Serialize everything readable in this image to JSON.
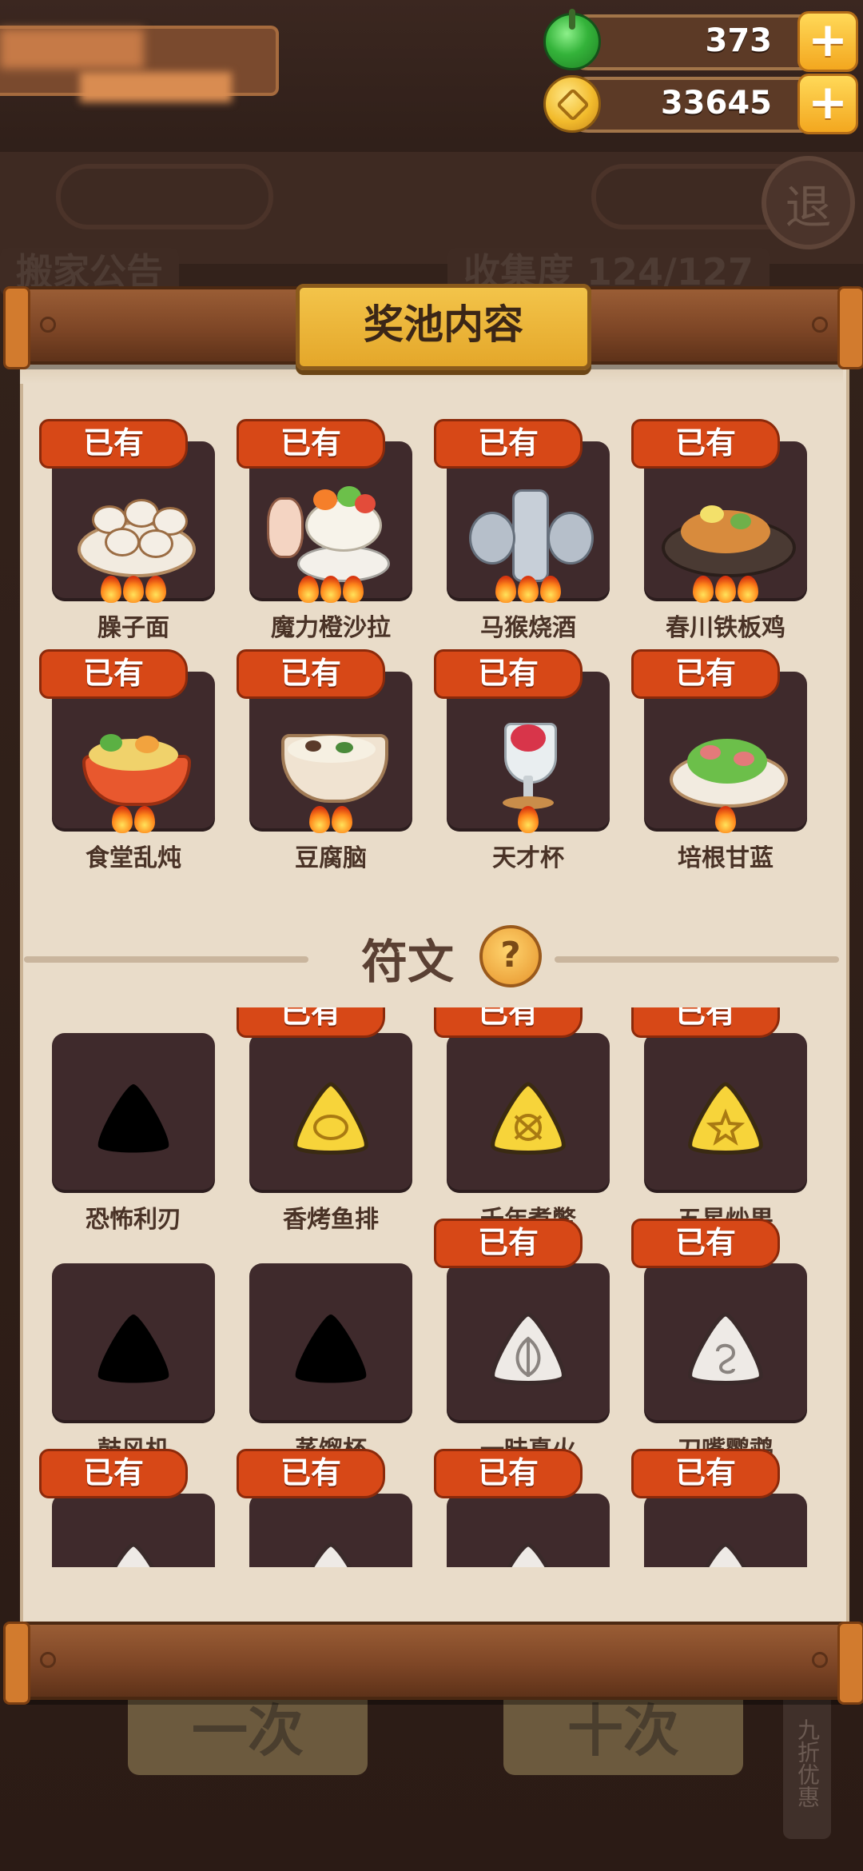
{
  "currency": {
    "gems": "373",
    "coins": "33645",
    "plus_label": "+"
  },
  "background": {
    "exit_label": "退",
    "left_label": "搬家公告",
    "right_label": "收集度 124/127",
    "button_one": "一次",
    "button_ten": "十次",
    "discount": "九折优惠"
  },
  "panel": {
    "title": "奖池内容",
    "owned_label": "已有",
    "dishes": [
      {
        "name": "臊子面",
        "owned": true,
        "flames": 3
      },
      {
        "name": "魔力橙沙拉",
        "owned": true,
        "flames": 3
      },
      {
        "name": "马猴烧酒",
        "owned": true,
        "flames": 3
      },
      {
        "name": "春川铁板鸡",
        "owned": true,
        "flames": 3
      },
      {
        "name": "食堂乱炖",
        "owned": true,
        "flames": 2
      },
      {
        "name": "豆腐脑",
        "owned": true,
        "flames": 2
      },
      {
        "name": "天才杯",
        "owned": true,
        "flames": 1
      },
      {
        "name": "培根甘蓝",
        "owned": true,
        "flames": 1
      }
    ],
    "runes_section_title": "符文",
    "help_label": "?",
    "runes": [
      {
        "name": "恐怖利刃",
        "owned": false,
        "style": "locked"
      },
      {
        "name": "香烤鱼排",
        "owned": true,
        "style": "gold"
      },
      {
        "name": "千年煮鳖",
        "owned": true,
        "style": "gold"
      },
      {
        "name": "五星炒果",
        "owned": true,
        "style": "gold"
      },
      {
        "name": "鼓风机",
        "owned": false,
        "style": "locked"
      },
      {
        "name": "蒸馏杯",
        "owned": false,
        "style": "locked"
      },
      {
        "name": "一昧真火",
        "owned": true,
        "style": "silver"
      },
      {
        "name": "刀嘴鹦鹉",
        "owned": true,
        "style": "silver"
      },
      {
        "name": "",
        "owned": true,
        "style": "silver"
      },
      {
        "name": "",
        "owned": true,
        "style": "silver"
      },
      {
        "name": "",
        "owned": true,
        "style": "silver"
      },
      {
        "name": "",
        "owned": true,
        "style": "silver"
      }
    ]
  },
  "colors": {
    "badge": "#d74817",
    "card": "#3f2a2c",
    "paper": "#e9dcc9",
    "gold_rune": "#f7d43a",
    "silver_rune": "#eeeae6"
  }
}
